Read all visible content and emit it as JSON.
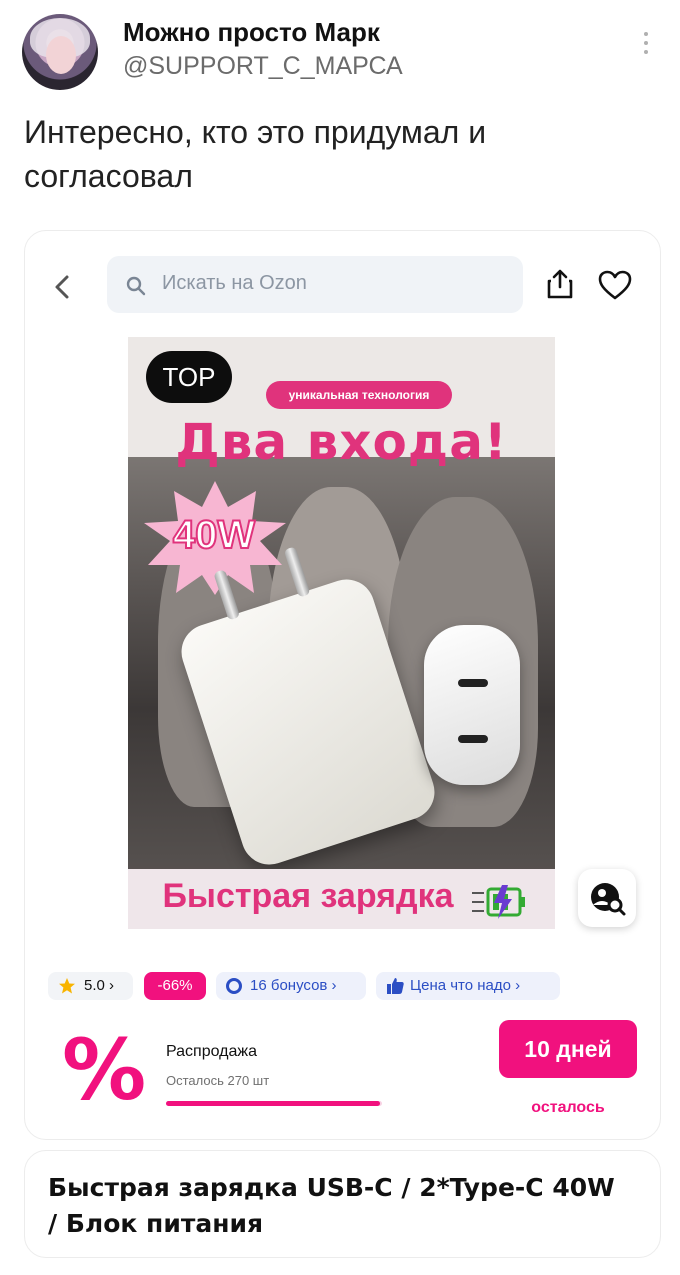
{
  "tweet": {
    "author_name": "Можно просто Марк",
    "author_handle": "@SUPPORT_C_МАРСА",
    "text": "Интересно, кто это придумал и согласовал"
  },
  "app_header": {
    "search_placeholder": "Искать на Ozon",
    "icons": [
      "back-arrow-icon",
      "search-icon",
      "share-icon",
      "heart-icon"
    ]
  },
  "product_image": {
    "top_badge": "TOP",
    "tech_pill": "уникальная технология",
    "headline": "Два входа!",
    "watt_label": "40W",
    "subtitle": "Быстрая зарядка"
  },
  "badges": {
    "rating": "5.0 ›",
    "discount": "-66%",
    "bonus": "16 бонусов ›",
    "price_note": "Цена что надо ›"
  },
  "sale": {
    "icon_glyph": "%",
    "title": "Распродажа",
    "remaining": "Осталось 270 шт",
    "progress": 0.99,
    "days_button": "10 дней",
    "days_caption": "осталось"
  },
  "product": {
    "title": "Быстрая зарядка USB-C / 2*Type-C 40W / Блок питания"
  },
  "colors": {
    "accent": "#f1117e",
    "pink_brand": "#e0337c",
    "bonus_blue": "#2b4ec4"
  }
}
